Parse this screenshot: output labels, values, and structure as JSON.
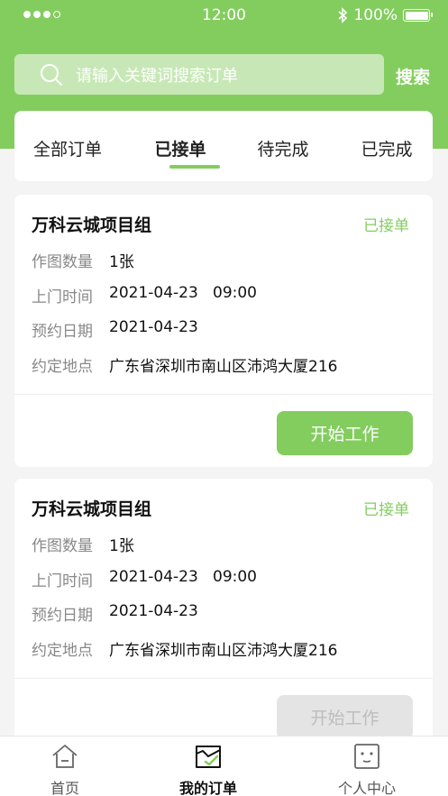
{
  "status_bar": {
    "time": "12:00",
    "battery": "100%"
  },
  "search": {
    "placeholder": "请输入关键词搜索订单",
    "button": "搜索"
  },
  "tabs": [
    {
      "label": "全部订单"
    },
    {
      "label": "已接单",
      "active": true
    },
    {
      "label": "待完成"
    },
    {
      "label": "已完成"
    }
  ],
  "orders": [
    {
      "title": "万科云城项目组",
      "status": "已接单",
      "fields": [
        {
          "label": "作图数量",
          "value": "1张"
        },
        {
          "label": "上门时间",
          "value": "2021-04-23   09:00"
        },
        {
          "label": "预约日期",
          "value": "2021-04-23"
        },
        {
          "label": "约定地点",
          "value": "广东省深圳市南山区沛鸿大厦216"
        }
      ],
      "action": "开始工作",
      "action_enabled": true
    },
    {
      "title": "万科云城项目组",
      "status": "已接单",
      "fields": [
        {
          "label": "作图数量",
          "value": "1张"
        },
        {
          "label": "上门时间",
          "value": "2021-04-23   09:00"
        },
        {
          "label": "预约日期",
          "value": "2021-04-23"
        },
        {
          "label": "约定地点",
          "value": "广东省深圳市南山区沛鸿大厦216"
        }
      ],
      "action": "开始工作",
      "action_enabled": false
    }
  ],
  "tabbar": [
    {
      "label": "首页",
      "icon": "home-icon"
    },
    {
      "label": "我的订单",
      "icon": "orders-icon",
      "active": true
    },
    {
      "label": "个人中心",
      "icon": "profile-icon"
    }
  ],
  "colors": {
    "accent": "#83cd5f",
    "background": "#f4f4f4"
  }
}
